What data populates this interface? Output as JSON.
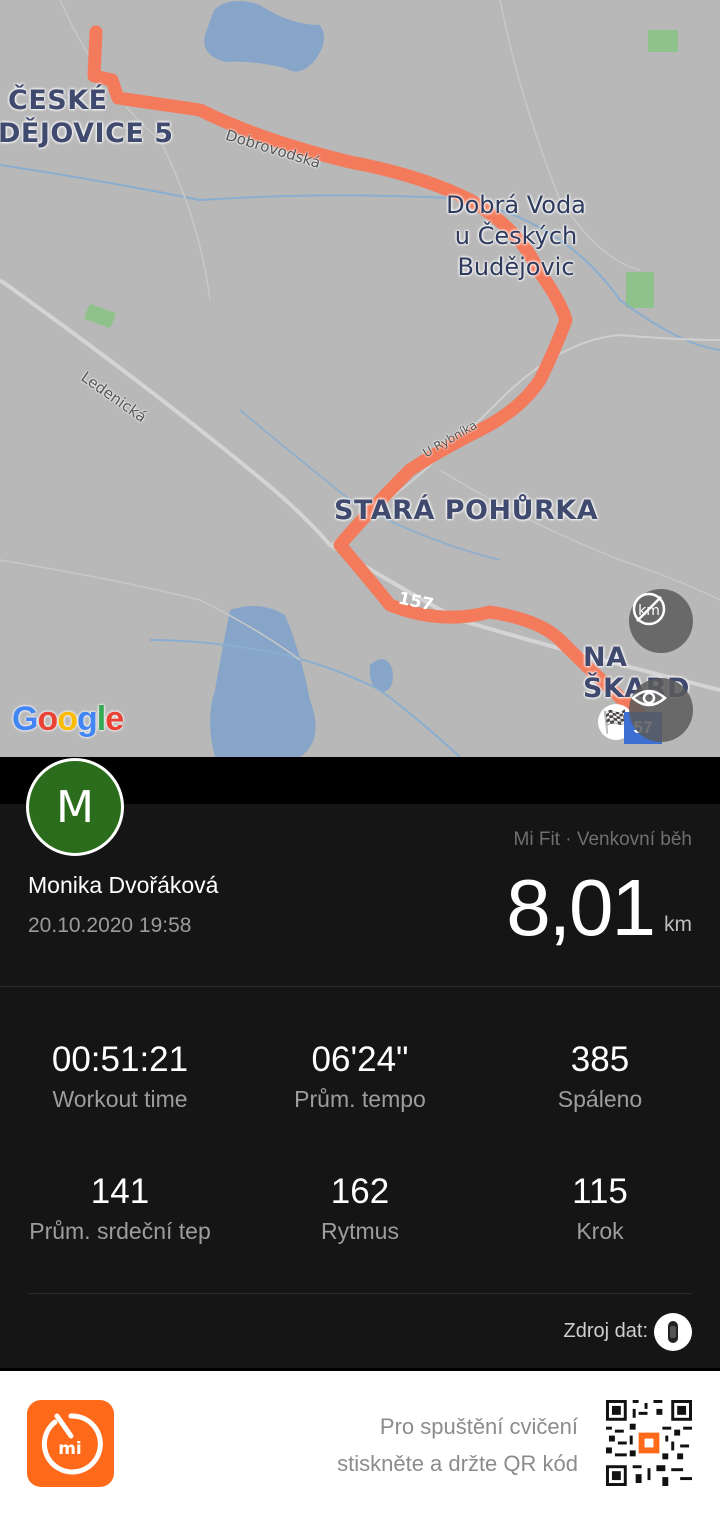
{
  "map": {
    "labels": {
      "district_ceske": "ČESKÉ",
      "district_budejovice": "DĚJOVICE 5",
      "town_line1": "Dobrá Voda",
      "town_line2": "u Českých",
      "town_line3": "Budějovic",
      "district_stara": "STARÁ POHŮRKA",
      "district_skard": "NA ŠKARD",
      "road_dobrovodska": "Dobrovodská",
      "road_ledenicka": "Ledenická",
      "road_urybnika": "U Rybníka",
      "road_number": "157",
      "route_badge": "57"
    },
    "google_logo": "Google",
    "route_color": "#f47a5c",
    "icons": [
      "distance-markers-off-icon",
      "eye-icon",
      "finish-flag-icon"
    ]
  },
  "workout": {
    "avatar_letter": "M",
    "avatar_color": "#2b6d1c",
    "user_name": "Monika Dvořáková",
    "datetime": "20.10.2020 19:58",
    "source": "Mi Fit · Venkovní běh",
    "distance": "8,01",
    "distance_unit": "km",
    "stats": [
      {
        "value": "00:51:21",
        "label": "Workout time"
      },
      {
        "value": "06'24\"",
        "label": "Prům. tempo"
      },
      {
        "value": "385",
        "label": "Spáleno"
      },
      {
        "value": "141",
        "label": "Prům. srdeční tep"
      },
      {
        "value": "162",
        "label": "Rytmus"
      },
      {
        "value": "115",
        "label": "Krok"
      }
    ],
    "data_source_label": "Zdroj dat:"
  },
  "footer": {
    "line1": "Pro spuštění cvičení",
    "line2": "stiskněte a držte QR kód",
    "brand_color": "#ff6a1a"
  }
}
